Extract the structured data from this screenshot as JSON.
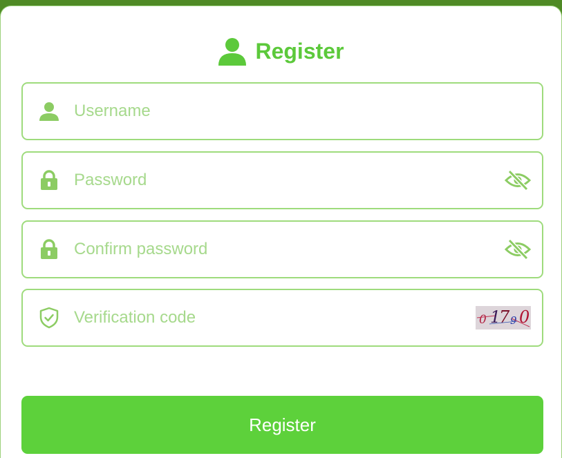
{
  "form": {
    "title": "Register",
    "title_icon": "user-icon",
    "accent_color": "#5cc93b",
    "button_color": "#5dd13b",
    "fields": {
      "username": {
        "placeholder": "Username",
        "value": "",
        "icon": "user-icon"
      },
      "password": {
        "placeholder": "Password",
        "value": "",
        "icon": "lock-icon",
        "toggle_icon": "eye-slash-icon"
      },
      "confirm_password": {
        "placeholder": "Confirm password",
        "value": "",
        "icon": "lock-icon",
        "toggle_icon": "eye-slash-icon"
      },
      "verification_code": {
        "placeholder": "Verification code",
        "value": "",
        "icon": "shield-check-icon"
      }
    },
    "captcha": {
      "text": [
        "0",
        "1",
        "7",
        "9",
        "0"
      ]
    },
    "submit_label": "Register"
  }
}
